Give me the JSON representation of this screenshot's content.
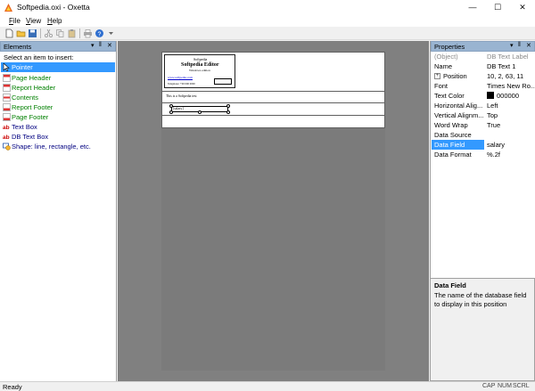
{
  "window": {
    "title": "Softpedia.oxi - Oxetta",
    "minimize": "—",
    "maximize": "☐",
    "close": "✕"
  },
  "menu": [
    {
      "label": "File",
      "accel": "F",
      "rest": "ile"
    },
    {
      "label": "View",
      "accel": "V",
      "rest": "iew"
    },
    {
      "label": "Help",
      "accel": "H",
      "rest": "elp"
    }
  ],
  "toolbar": {
    "icons": [
      "new-file-icon",
      "open-folder-icon",
      "save-icon",
      "cut-icon",
      "copy-icon",
      "paste-icon",
      "print-icon",
      "print-preview-icon",
      "help-icon",
      "toolbar-overflow-icon"
    ]
  },
  "elements_panel": {
    "title": "Elements",
    "controls": "▾ ‖ ✕",
    "hint": "Select an item to insert:",
    "items": [
      {
        "label": "Pointer",
        "icon": "pointer-icon",
        "color": "#ffffff",
        "selected": true
      },
      {
        "label": "Page Header",
        "icon": "page-header-icon",
        "color": "#008000"
      },
      {
        "label": "Report Header",
        "icon": "report-header-icon",
        "color": "#008000"
      },
      {
        "label": "Contents",
        "icon": "contents-icon",
        "color": "#008000"
      },
      {
        "label": "Report Footer",
        "icon": "report-footer-icon",
        "color": "#008000"
      },
      {
        "label": "Page Footer",
        "icon": "page-footer-icon",
        "color": "#008000"
      },
      {
        "label": "Text Box",
        "icon": "text-box-icon",
        "color": "#000080"
      },
      {
        "label": "DB Text Box",
        "icon": "db-text-box-icon",
        "color": "#000080"
      },
      {
        "label": "Shape: line, rectangle, etc.",
        "icon": "shape-icon",
        "color": "#000080"
      }
    ]
  },
  "report": {
    "header_line1": "Softpedia",
    "header_title": "Softpedia Editor",
    "header_sub": "Windows edition",
    "header_link": "www.softpedia.com",
    "header_phone": "Telephone: +00 000 0000",
    "content_text": "This is a Softpedia test",
    "db_field_text": "[salary]"
  },
  "properties_panel": {
    "title": "Properties",
    "controls": "▾ ‖ ✕",
    "rows": [
      {
        "name": "(Object)",
        "value": "DB Text Label",
        "gray": true
      },
      {
        "name": "Name",
        "value": "DB Text 1"
      },
      {
        "name": "Position",
        "value": "10, 2, 63, 11",
        "expandable": true
      },
      {
        "name": "Font",
        "value": "Times New Ro..."
      },
      {
        "name": "Text Color",
        "value": "000000",
        "swatch": "#000000"
      },
      {
        "name": "Horizontal Alig...",
        "value": "Left"
      },
      {
        "name": "Vertical Alignm...",
        "value": "Top"
      },
      {
        "name": "Word Wrap",
        "value": "True"
      },
      {
        "name": "Data Source",
        "value": ""
      },
      {
        "name": "Data Field",
        "value": "salary",
        "selected": true
      },
      {
        "name": "Data Format",
        "value": "%.2f"
      }
    ],
    "description_title": "Data Field",
    "description_text": "The name of the database field to display in this position"
  },
  "status": {
    "text": "Ready",
    "indicators": [
      "CAP",
      "NUM",
      "SCRL"
    ]
  },
  "colors": {
    "accent": "#3399ff",
    "panel_header": "#99b4d1",
    "green_items": "#008000",
    "navy_items": "#000080"
  }
}
